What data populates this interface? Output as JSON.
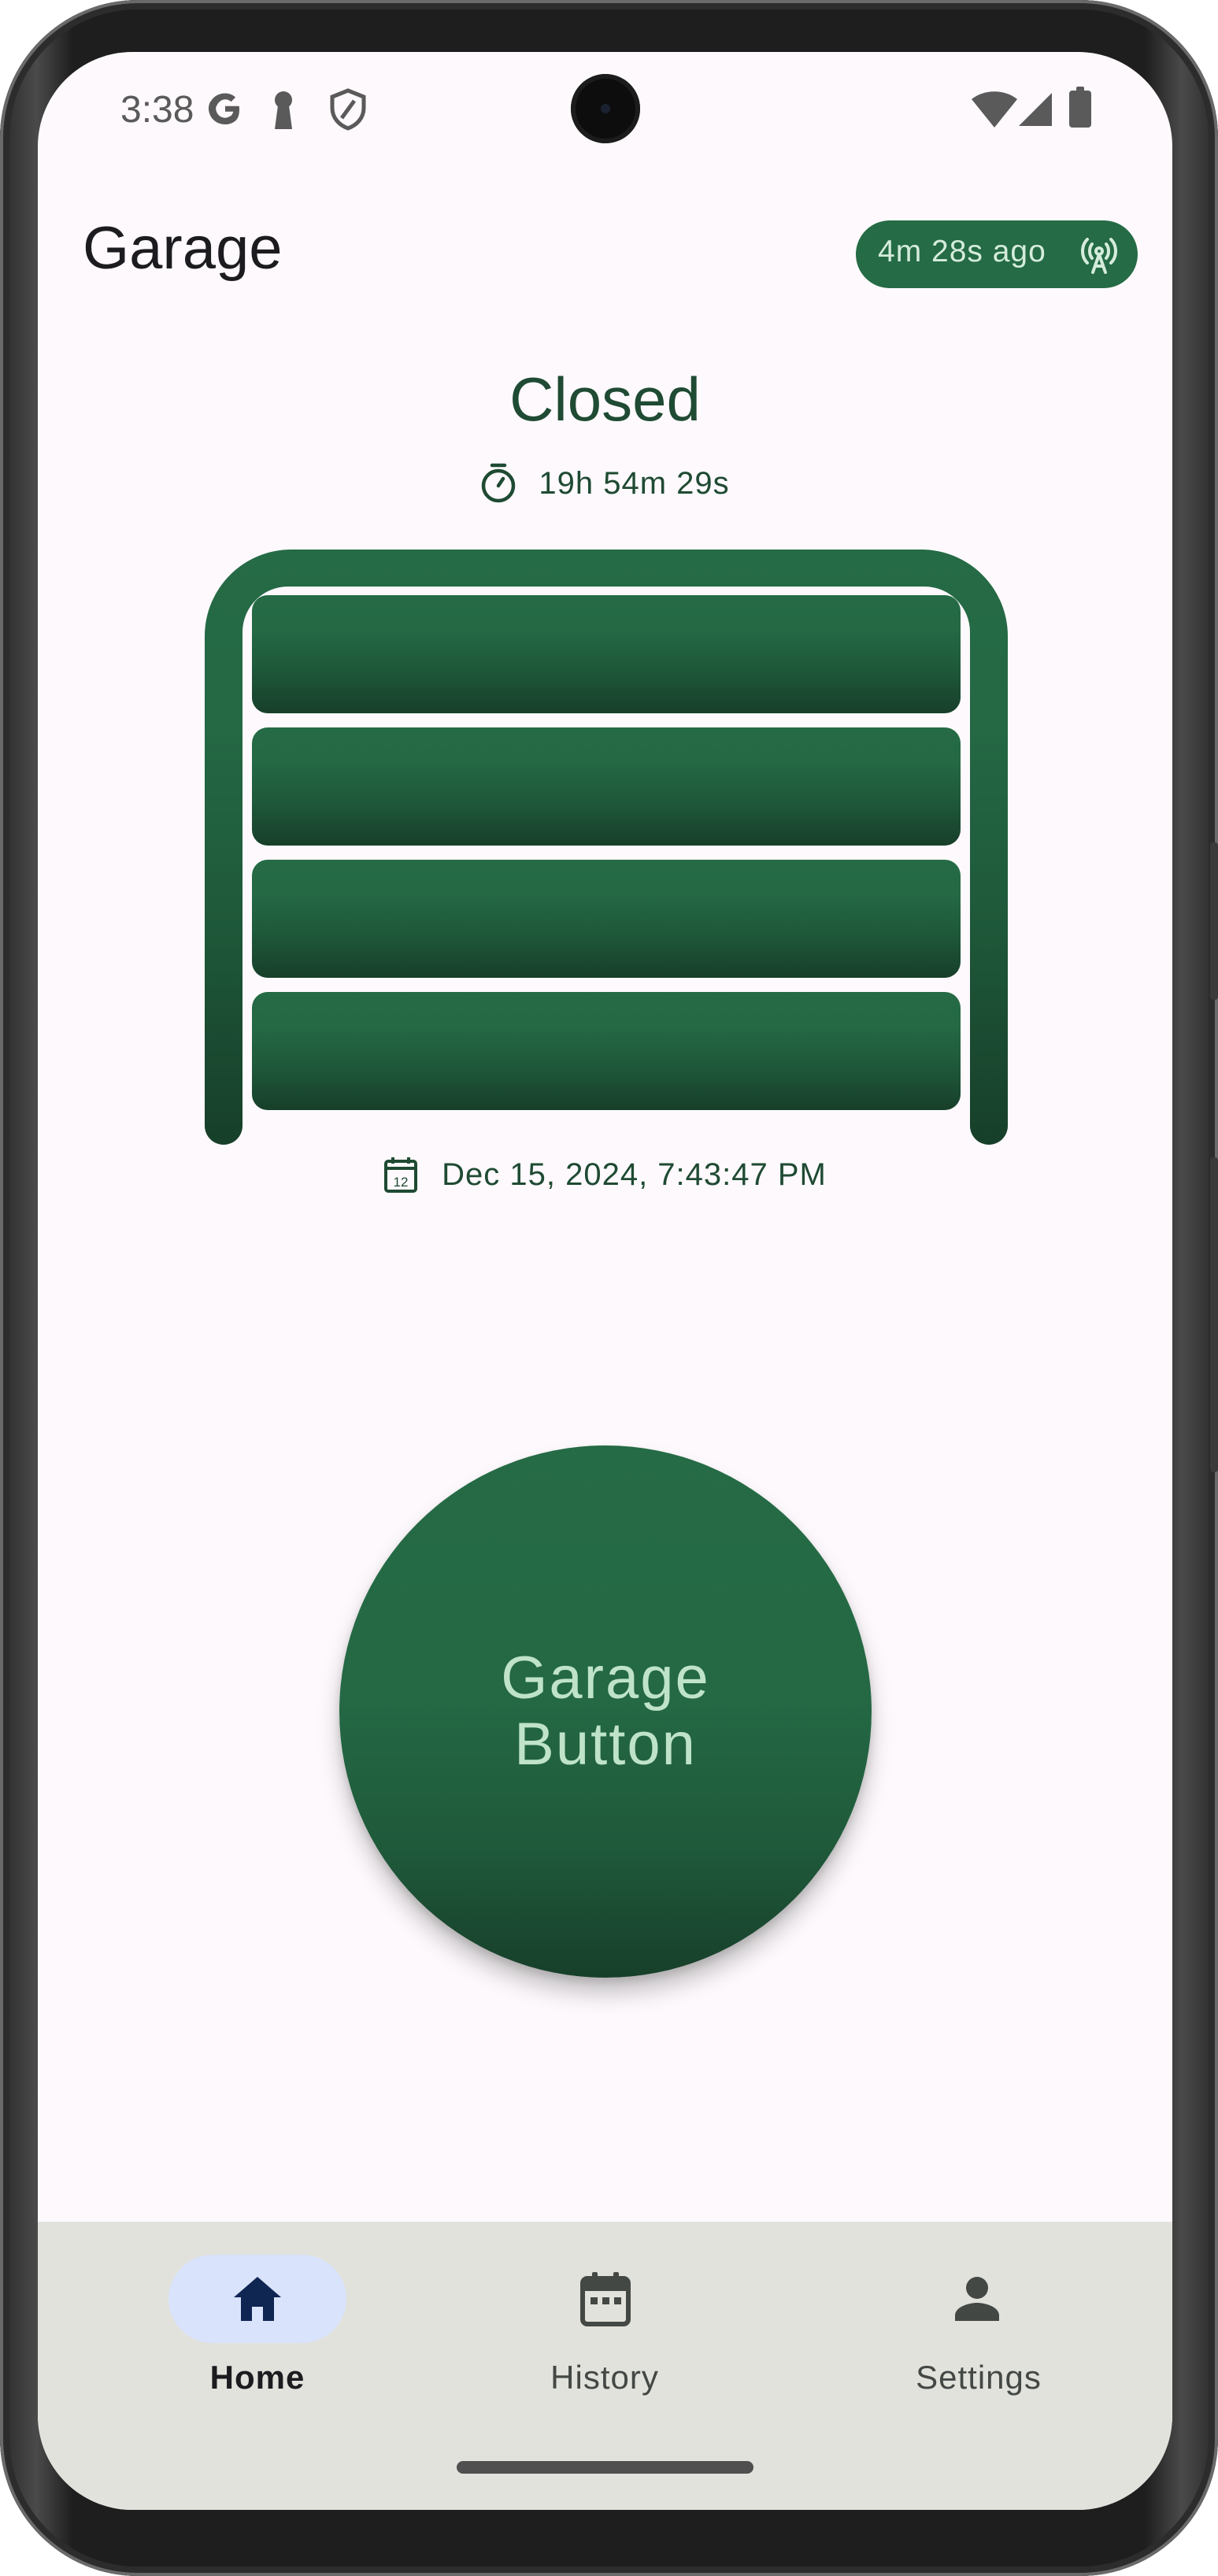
{
  "status_bar": {
    "time": "3:38"
  },
  "header": {
    "title": "Garage",
    "connection_chip": "4m 28s ago"
  },
  "door": {
    "state": "Closed",
    "duration": "19h 54m 29s",
    "timestamp": "Dec 15, 2024, 7:43:47 PM",
    "calendar_day": "12"
  },
  "garage_button": {
    "label": "Garage Button"
  },
  "bottom_nav": {
    "items": [
      {
        "label": "Home",
        "icon": "home-icon",
        "selected": true
      },
      {
        "label": "History",
        "icon": "calendar-icon",
        "selected": false
      },
      {
        "label": "Settings",
        "icon": "person-icon",
        "selected": false
      }
    ]
  },
  "colors": {
    "primary": "#256b45",
    "primary_dark": "#173f2a",
    "on_primary_container": "#1f4a33",
    "background": "#fdf9fc",
    "nav_background": "#e1e2dc",
    "nav_selected_pill": "#d9e3fb",
    "nav_selected_icon": "#0f2552"
  }
}
